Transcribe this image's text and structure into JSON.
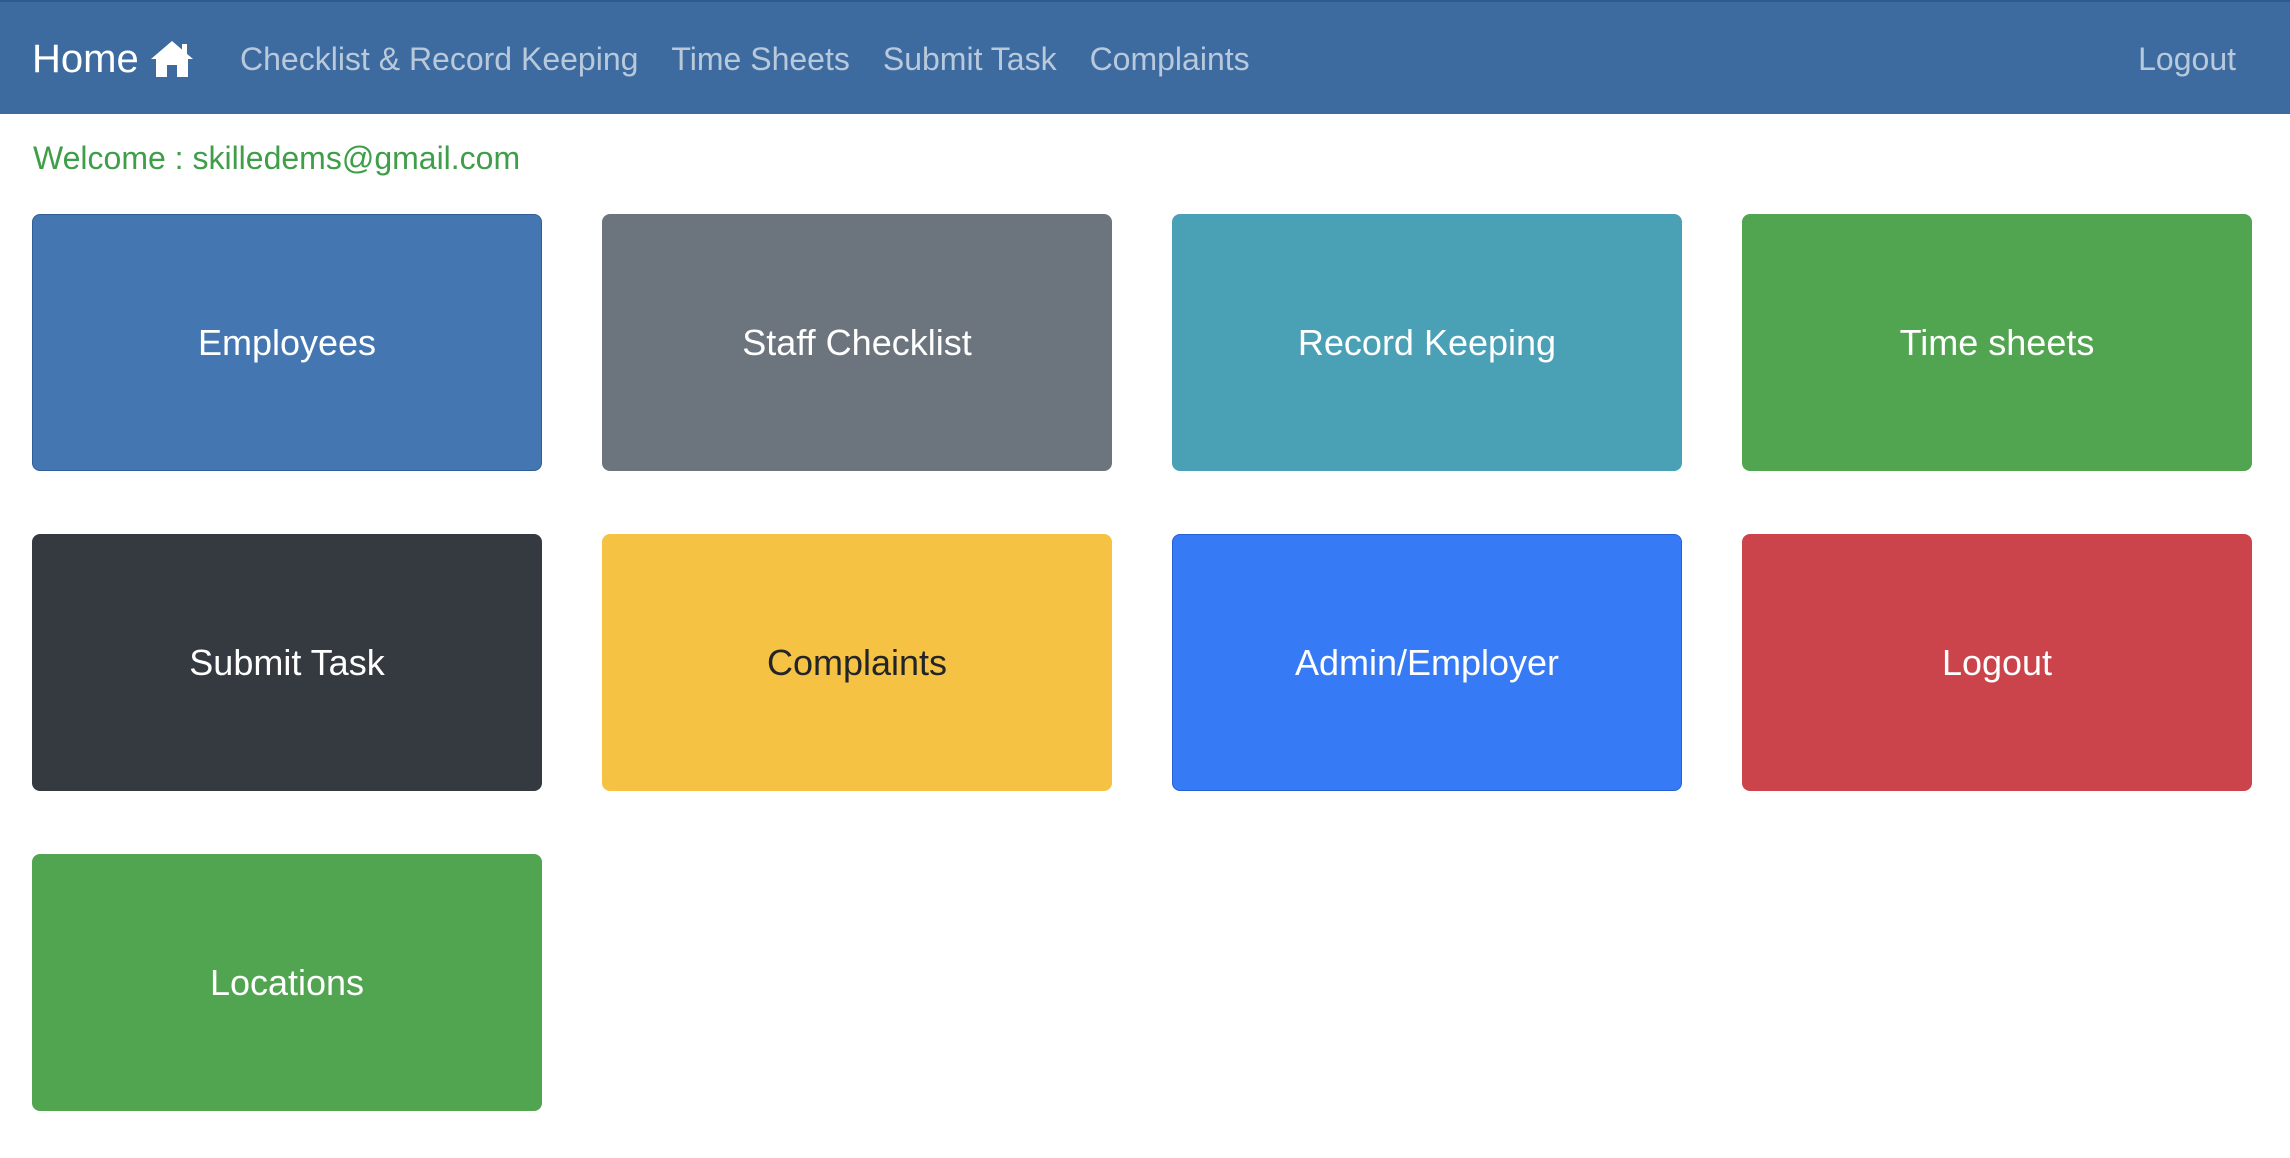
{
  "navbar": {
    "brand_label": "Home",
    "brand_icon": "home-icon",
    "links": [
      {
        "label": "Checklist & Record Keeping"
      },
      {
        "label": "Time Sheets"
      },
      {
        "label": "Submit Task"
      },
      {
        "label": "Complaints"
      }
    ],
    "logout_label": "Logout",
    "background_color": "#3d6ba0"
  },
  "welcome": {
    "text": "Welcome : skilledems@gmail.com",
    "color": "#3f9e48"
  },
  "tiles": [
    {
      "label": "Employees",
      "color": "#4477b2"
    },
    {
      "label": "Staff Checklist",
      "color": "#6c757d"
    },
    {
      "label": "Record Keeping",
      "color": "#4aa0b5"
    },
    {
      "label": "Time sheets",
      "color": "#52a550"
    },
    {
      "label": "Submit Task",
      "color": "#343a40"
    },
    {
      "label": "Complaints",
      "color": "#f5c244"
    },
    {
      "label": "Admin/Employer",
      "color": "#367bf5"
    },
    {
      "label": "Logout",
      "color": "#cc444b"
    },
    {
      "label": "Locations",
      "color": "#52a550"
    }
  ]
}
